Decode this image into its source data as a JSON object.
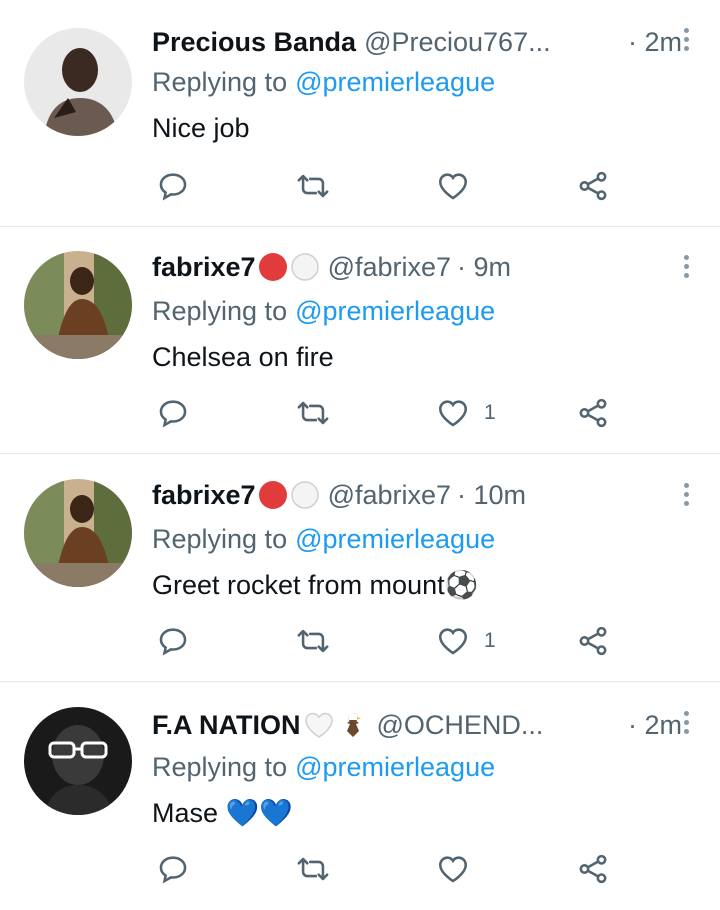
{
  "reply_prefix": "Replying to",
  "tweets": [
    {
      "name": "Precious Banda",
      "handle": "@Preciou767...",
      "time": "· 2m",
      "reply_to": "@premierleague",
      "text": "Nice job",
      "likes": "",
      "avatar_icon": "portrait-photo"
    },
    {
      "name": "fabrixe7",
      "handle": "@fabrixe7",
      "time": "· 9m",
      "reply_to": "@premierleague",
      "text": "Chelsea on fire",
      "likes": "1",
      "avatar_icon": "portrait-photo"
    },
    {
      "name": "fabrixe7",
      "handle": "@fabrixe7",
      "time": "· 10m",
      "reply_to": "@premierleague",
      "text": "Greet rocket from mount⚽",
      "likes": "1",
      "avatar_icon": "portrait-photo"
    },
    {
      "name": "F.A NATION",
      "handle": "@OCHEND...",
      "time": "· 2m",
      "reply_to": "@premierleague",
      "text": "Mase 💙💙",
      "likes": "",
      "avatar_icon": "portrait-photo"
    }
  ],
  "colors": {
    "accent": "#1d9bf0",
    "secondary_text": "#536471",
    "icon": "#536471",
    "divider": "#e1e8ed"
  }
}
